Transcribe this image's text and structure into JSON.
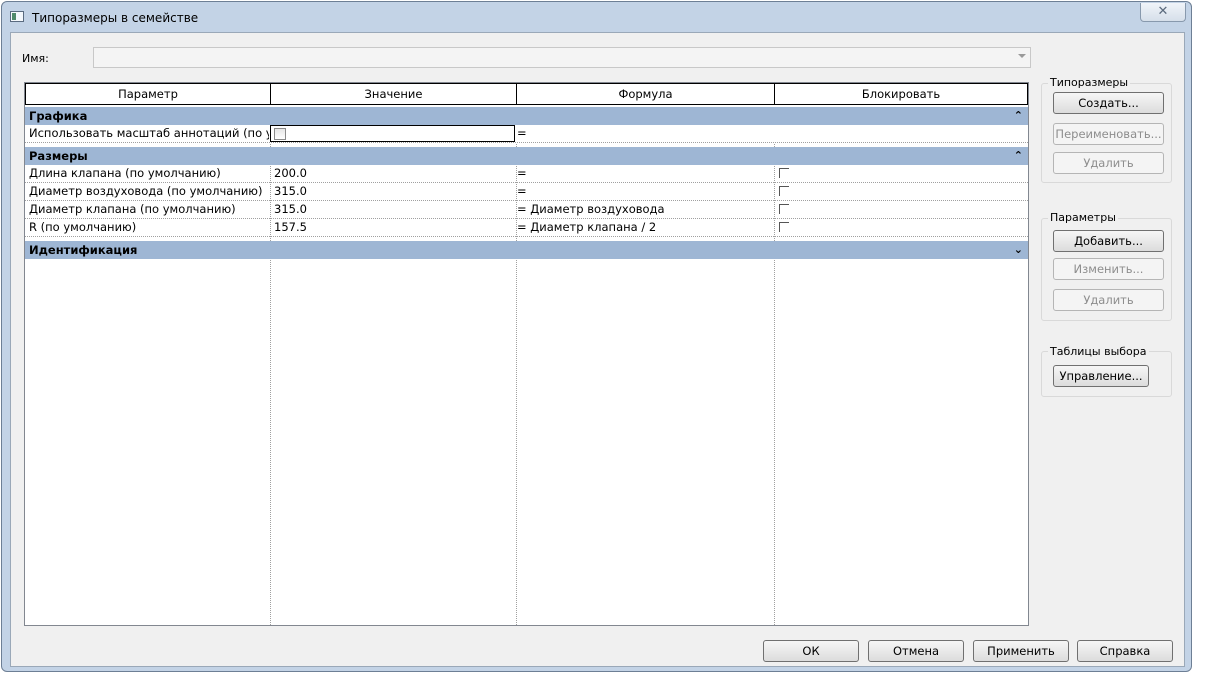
{
  "window": {
    "title": "Типоразмеры в семействе",
    "close_glyph": "✕"
  },
  "name_field": {
    "label": "Имя:",
    "value": ""
  },
  "columns": [
    "Параметр",
    "Значение",
    "Формула",
    "Блокировать"
  ],
  "groups": {
    "graphics": {
      "label": "Графика",
      "chevron": "⌃"
    },
    "dimensions": {
      "label": "Размеры",
      "chevron": "⌃"
    },
    "identity": {
      "label": "Идентификация",
      "chevron": "⌄"
    }
  },
  "rows": {
    "annot": {
      "param": "Использовать масштаб аннотаций (по умо",
      "formula": "="
    },
    "r1": {
      "param": "Длина клапана (по умолчанию)",
      "value": "200.0",
      "formula": "="
    },
    "r2": {
      "param": "Диаметр воздуховода (по умолчанию)",
      "value": "315.0",
      "formula": "="
    },
    "r3": {
      "param": "Диаметр клапана (по умолчанию)",
      "value": "315.0",
      "formula": "= Диаметр воздуховода"
    },
    "r4": {
      "param": "R (по умолчанию)",
      "value": "157.5",
      "formula": "= Диаметр клапана / 2"
    }
  },
  "types_group": {
    "title": "Типоразмеры",
    "create": "Создать...",
    "rename": "Переименовать...",
    "delete": "Удалить"
  },
  "params_group": {
    "title": "Параметры",
    "add": "Добавить...",
    "modify": "Изменить...",
    "delete": "Удалить"
  },
  "lookup_group": {
    "title": "Таблицы выбора",
    "manage": "Управление..."
  },
  "footer": {
    "ok": "ОК",
    "cancel": "Отмена",
    "apply": "Применить",
    "help": "Справка"
  },
  "icons": {
    "app": "family-types-icon",
    "close": "close-icon",
    "combo": "chevron-down-icon",
    "collapse": "collapse-icon",
    "expand": "expand-icon",
    "checkbox": "checkbox-icon"
  }
}
